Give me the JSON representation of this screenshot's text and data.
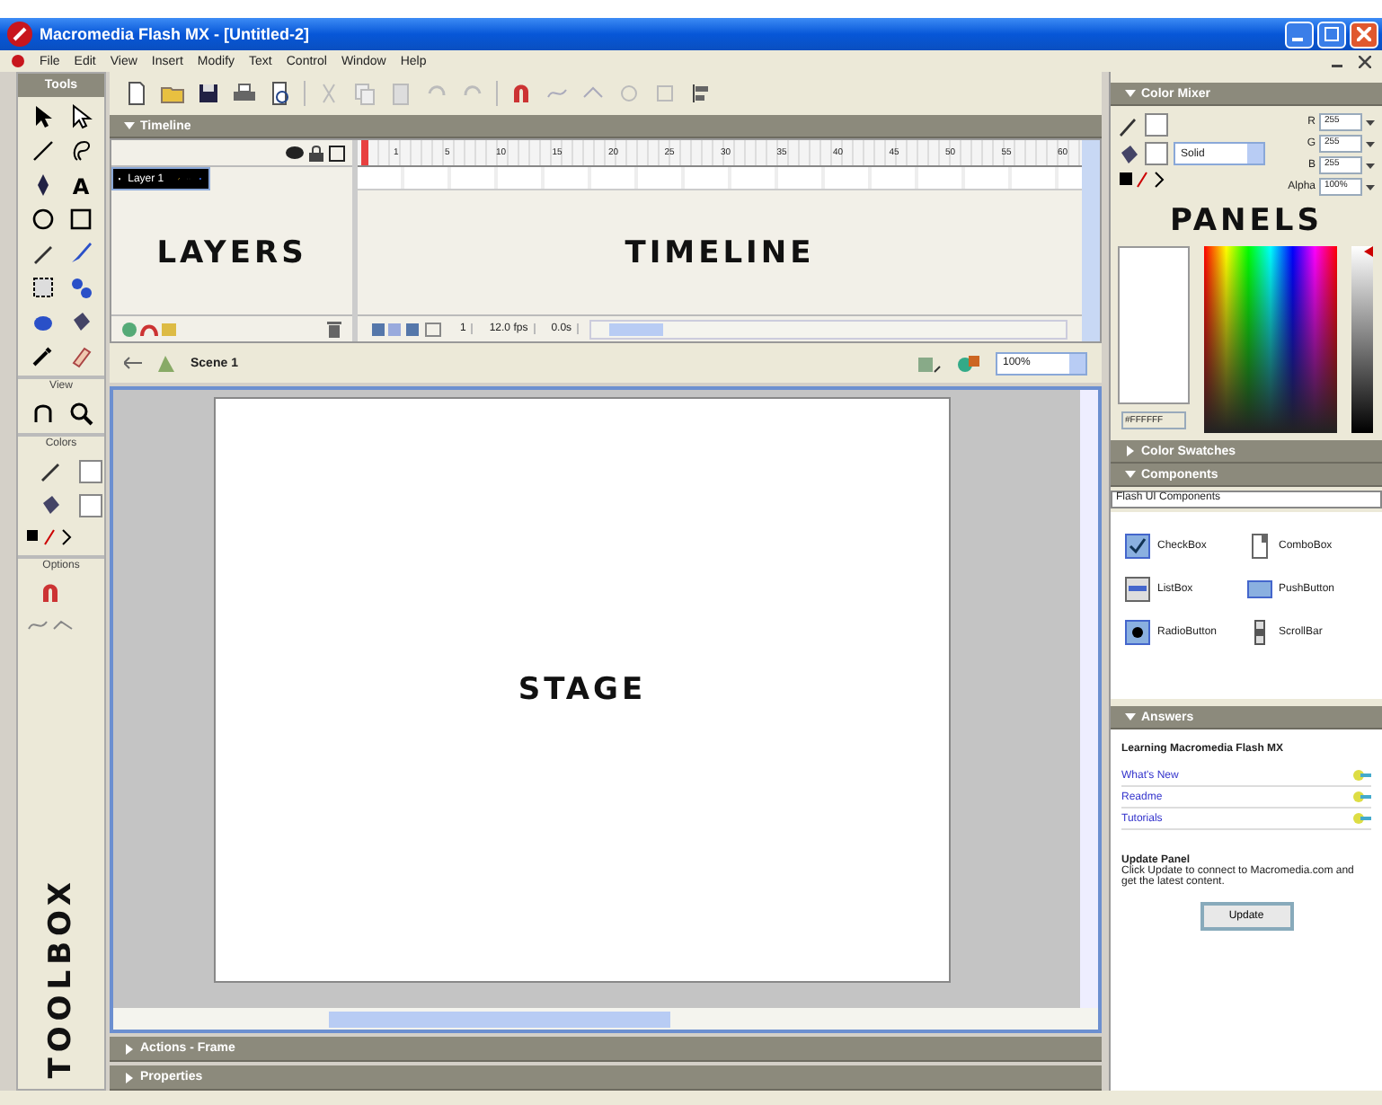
{
  "window": {
    "title": "Macromedia Flash MX - [Untitled-2]"
  },
  "menu": [
    "File",
    "Edit",
    "View",
    "Insert",
    "Modify",
    "Text",
    "Control",
    "Window",
    "Help"
  ],
  "toolbox": {
    "header": "Tools",
    "text_tool_glyph": "A",
    "sections": [
      "View",
      "Colors",
      "Options"
    ],
    "annotation": "TOOLBOX"
  },
  "timeline": {
    "title": "Timeline",
    "expanded": true,
    "layers": [
      {
        "name": "Layer 1",
        "selected": true
      }
    ],
    "ruler": [
      "1",
      "5",
      "10",
      "15",
      "20",
      "25",
      "30",
      "35",
      "40",
      "45",
      "50",
      "55",
      "60"
    ],
    "current_frame": "1",
    "frame_rate": "12.0 fps",
    "elapsed": "0.0s",
    "layers_annotation": "LAYERS",
    "timeline_annotation": "TIMELINE"
  },
  "scene": {
    "name": "Scene 1",
    "zoom": "100%"
  },
  "stage": {
    "annotation": "STAGE"
  },
  "bottom_panels": [
    {
      "title": "Actions - Frame",
      "expanded": false
    },
    {
      "title": "Properties",
      "expanded": false
    }
  ],
  "panels": {
    "annotation": "PANELS",
    "color_mixer": {
      "title": "Color Mixer",
      "expanded": true,
      "fill_type": "Solid",
      "hex": "#FFFFFF",
      "brightness": {
        "level": 1
      },
      "channels": [
        {
          "label": "R",
          "value": "255"
        },
        {
          "label": "G",
          "value": "255"
        },
        {
          "label": "B",
          "value": "255"
        },
        {
          "label": "Alpha",
          "value": "100%"
        }
      ]
    },
    "color_swatches": {
      "title": "Color Swatches",
      "expanded": false
    },
    "components": {
      "title": "Components",
      "expanded": true,
      "set": "Flash UI Components",
      "items": [
        {
          "name": "CheckBox",
          "kind": "checkbox"
        },
        {
          "name": "ComboBox",
          "kind": "combobox"
        },
        {
          "name": "ListBox",
          "kind": "listbox"
        },
        {
          "name": "PushButton",
          "kind": "pushbutton"
        },
        {
          "name": "RadioButton",
          "kind": "radiobutton"
        },
        {
          "name": "ScrollBar",
          "kind": "scrollbar"
        }
      ]
    },
    "answers": {
      "title": "Answers",
      "expanded": true,
      "heading": "Learning Macromedia Flash MX",
      "links": [
        "What's New",
        "Readme",
        "Tutorials"
      ],
      "update_heading": "Update Panel",
      "update_text": "Click Update to connect to Macromedia.com and get the latest content.",
      "update_button": "Update"
    }
  }
}
